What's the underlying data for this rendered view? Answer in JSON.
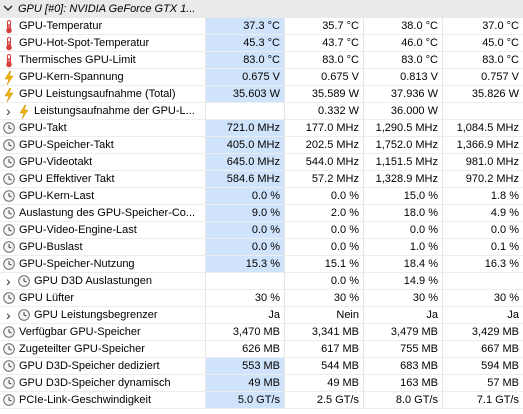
{
  "colors": {
    "selection": "#cfe3fb",
    "group_bg": "#eaeaea",
    "thermo": "#d84040",
    "bolt": "#f0b400"
  },
  "rows": [
    {
      "type": "group",
      "label": "GPU [#0]: NVIDIA GeForce GTX 1...",
      "icon": "chevron-down-icon",
      "values": [
        "",
        "",
        "",
        ""
      ]
    },
    {
      "label": "GPU-Temperatur",
      "icon": "thermometer-icon",
      "values": [
        "37.3 °C",
        "35.7 °C",
        "38.0 °C",
        "37.0 °C"
      ],
      "sel": true
    },
    {
      "label": "GPU-Hot-Spot-Temperatur",
      "icon": "thermometer-icon",
      "values": [
        "45.3 °C",
        "43.7 °C",
        "46.0 °C",
        "45.0 °C"
      ],
      "sel": true
    },
    {
      "label": "Thermisches GPU-Limit",
      "icon": "thermometer-icon",
      "values": [
        "83.0 °C",
        "83.0 °C",
        "83.0 °C",
        "83.0 °C"
      ],
      "sel": true
    },
    {
      "label": "GPU-Kern-Spannung",
      "icon": "lightning-icon",
      "values": [
        "0.675 V",
        "0.675 V",
        "0.813 V",
        "0.757 V"
      ],
      "sel": true
    },
    {
      "label": "GPU Leistungsaufnahme (Total)",
      "icon": "lightning-icon",
      "values": [
        "35.603 W",
        "35.589 W",
        "37.936 W",
        "35.826 W"
      ],
      "sel": true
    },
    {
      "label": "Leistungsaufnahme der GPU-L...",
      "icon": "lightning-icon",
      "expander": true,
      "values": [
        "",
        "0.332 W",
        "36.000 W",
        ""
      ]
    },
    {
      "label": "GPU-Takt",
      "icon": "clock-icon",
      "values": [
        "721.0 MHz",
        "177.0 MHz",
        "1,290.5 MHz",
        "1,084.5 MHz"
      ],
      "sel": true
    },
    {
      "label": "GPU-Speicher-Takt",
      "icon": "clock-icon",
      "values": [
        "405.0 MHz",
        "202.5 MHz",
        "1,752.0 MHz",
        "1,366.9 MHz"
      ],
      "sel": true
    },
    {
      "label": "GPU-Videotakt",
      "icon": "clock-icon",
      "values": [
        "645.0 MHz",
        "544.0 MHz",
        "1,151.5 MHz",
        "981.0 MHz"
      ],
      "sel": true
    },
    {
      "label": "GPU Effektiver Takt",
      "icon": "clock-icon",
      "values": [
        "584.6 MHz",
        "57.2 MHz",
        "1,328.9 MHz",
        "970.2 MHz"
      ],
      "sel": true
    },
    {
      "label": "GPU-Kern-Last",
      "icon": "clock-icon",
      "values": [
        "0.0 %",
        "0.0 %",
        "15.0 %",
        "1.8 %"
      ],
      "sel": true
    },
    {
      "label": "Auslastung des GPU-Speicher-Co...",
      "icon": "clock-icon",
      "values": [
        "9.0 %",
        "2.0 %",
        "18.0 %",
        "4.9 %"
      ],
      "sel": true
    },
    {
      "label": "GPU-Video-Engine-Last",
      "icon": "clock-icon",
      "values": [
        "0.0 %",
        "0.0 %",
        "0.0 %",
        "0.0 %"
      ],
      "sel": true
    },
    {
      "label": "GPU-Buslast",
      "icon": "clock-icon",
      "values": [
        "0.0 %",
        "0.0 %",
        "1.0 %",
        "0.1 %"
      ],
      "sel": true
    },
    {
      "label": "GPU-Speicher-Nutzung",
      "icon": "clock-icon",
      "values": [
        "15.3 %",
        "15.1 %",
        "18.4 %",
        "16.3 %"
      ],
      "sel": true
    },
    {
      "label": "GPU D3D Auslastungen",
      "icon": "clock-icon",
      "expander": true,
      "values": [
        "",
        "0.0 %",
        "14.9 %",
        ""
      ]
    },
    {
      "label": "GPU Lüfter",
      "icon": "clock-icon",
      "values": [
        "30 %",
        "30 %",
        "30 %",
        "30 %"
      ]
    },
    {
      "label": "GPU Leistungsbegrenzer",
      "icon": "clock-icon",
      "expander": true,
      "values": [
        "Ja",
        "Nein",
        "Ja",
        "Ja"
      ]
    },
    {
      "label": "Verfügbar GPU-Speicher",
      "icon": "clock-icon",
      "values": [
        "3,470 MB",
        "3,341 MB",
        "3,479 MB",
        "3,429 MB"
      ]
    },
    {
      "label": "Zugeteilter GPU-Speicher",
      "icon": "clock-icon",
      "values": [
        "626 MB",
        "617 MB",
        "755 MB",
        "667 MB"
      ]
    },
    {
      "label": "GPU D3D-Speicher dediziert",
      "icon": "clock-icon",
      "values": [
        "553 MB",
        "544 MB",
        "683 MB",
        "594 MB"
      ],
      "sel": true
    },
    {
      "label": "GPU D3D-Speicher dynamisch",
      "icon": "clock-icon",
      "values": [
        "49 MB",
        "49 MB",
        "163 MB",
        "57 MB"
      ],
      "sel": true
    },
    {
      "label": "PCIe-Link-Geschwindigkeit",
      "icon": "clock-icon",
      "values": [
        "5.0 GT/s",
        "2.5 GT/s",
        "8.0 GT/s",
        "7.1 GT/s"
      ],
      "sel": true
    }
  ]
}
